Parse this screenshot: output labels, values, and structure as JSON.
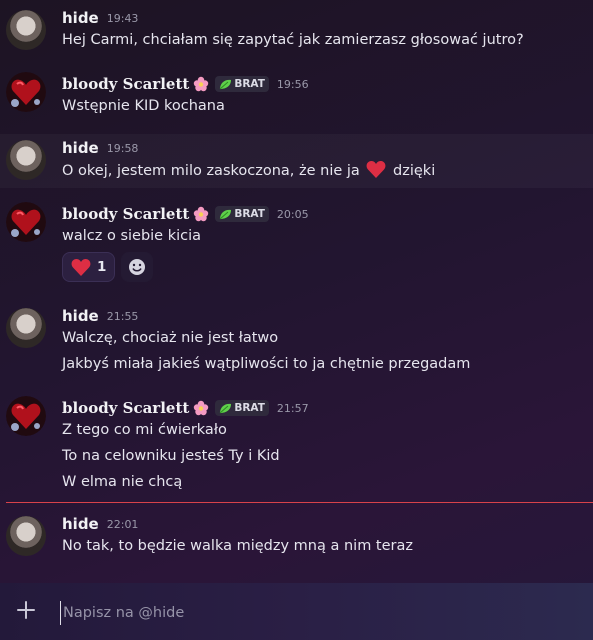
{
  "messages": [
    {
      "author": "hide",
      "time": "19:43",
      "lines": [
        "Hej Carmi, chciałam się zapytać jak zamierzasz głosować jutro?"
      ]
    },
    {
      "author": "bloody Scarlett",
      "badge": "BRAT",
      "time": "19:56",
      "lines": [
        "Wstępnie KID kochana"
      ]
    },
    {
      "author": "hide",
      "time": "19:58",
      "line_before_emoji": "O okej, jestem milo zaskoczona, że nie ja",
      "emoji": "heart-emoji",
      "line_after_emoji": "dzięki"
    },
    {
      "author": "bloody Scarlett",
      "badge": "BRAT",
      "time": "20:05",
      "lines": [
        "walcz o siebie kicia"
      ],
      "reaction": {
        "emoji": "heart-emoji",
        "count": "1"
      }
    },
    {
      "author": "hide",
      "time": "21:55",
      "lines": [
        "Walczę, chociaż nie jest łatwo",
        "Jakbyś miała jakieś wątpliwości to ja chętnie przegadam"
      ]
    },
    {
      "author": "bloody Scarlett",
      "badge": "BRAT",
      "time": "21:57",
      "lines": [
        "Z tego co mi ćwierkało",
        "To na celowniku jesteś Ty i Kid",
        "W elma nie chcą"
      ]
    },
    {
      "author": "hide",
      "time": "22:01",
      "lines": [
        "No tak, to będzie walka między mną a nim teraz"
      ]
    }
  ],
  "composer": {
    "placeholder": "Napisz na @hide"
  },
  "colors": {
    "new_messages_divider": "#d8424a",
    "heart": "#dd2e44",
    "badge_leaf": "#5fd14a"
  }
}
